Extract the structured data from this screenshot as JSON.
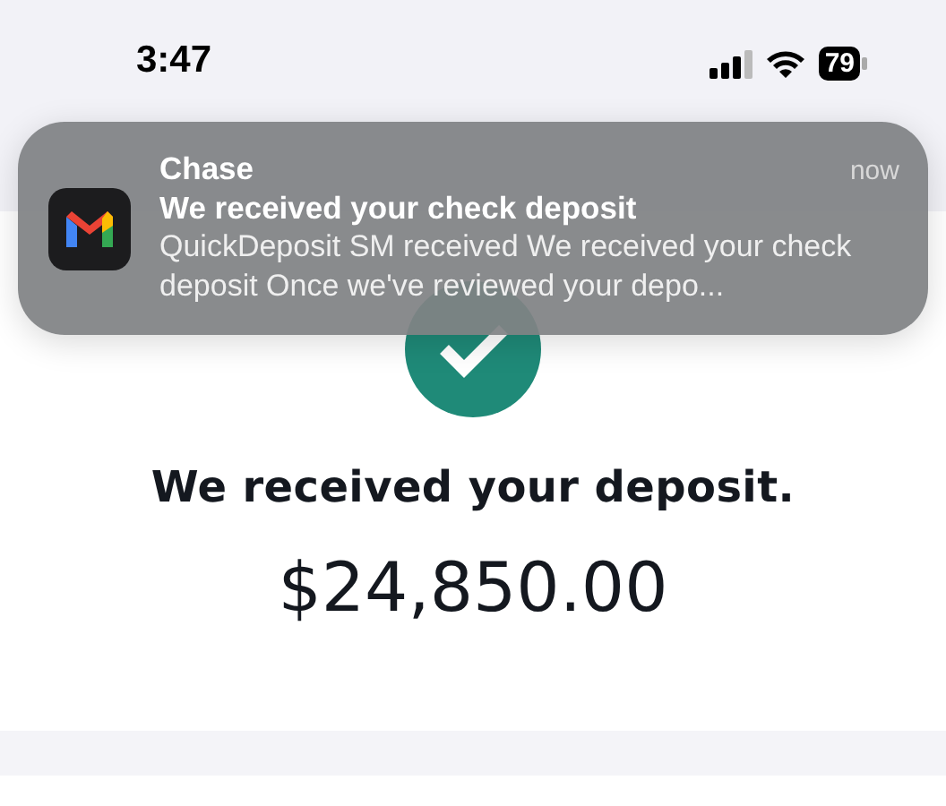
{
  "status_bar": {
    "time": "3:47",
    "battery": "79"
  },
  "notification": {
    "app": "Chase",
    "time": "now",
    "title": "We received your check deposit",
    "body": "QuickDeposit SM received We received your check deposit Once we've reviewed your depo..."
  },
  "confirmation": {
    "title": "We received your deposit.",
    "amount": "$24,850.00"
  }
}
